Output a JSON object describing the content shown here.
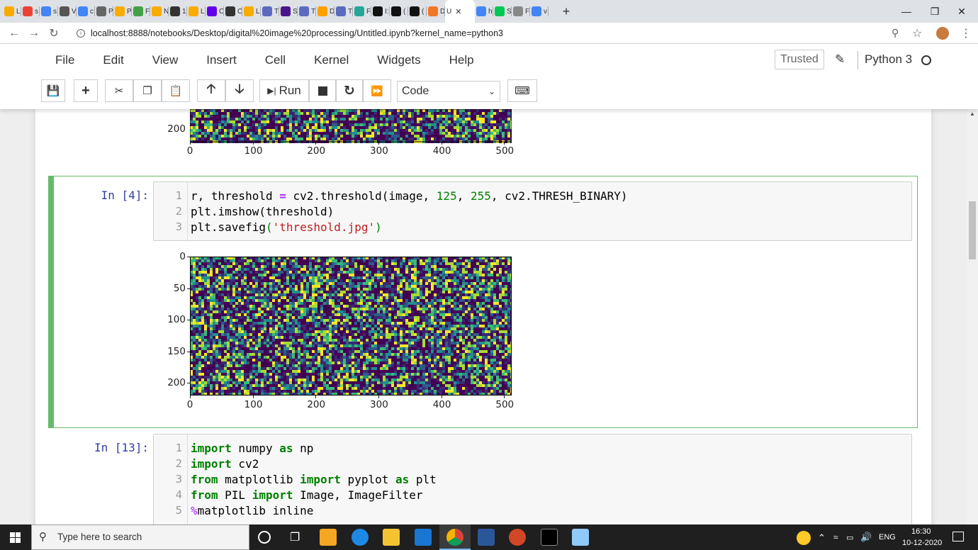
{
  "browser": {
    "tabs": [
      {
        "label": "L",
        "icon": "colab-icon",
        "color": "#f9ab00"
      },
      {
        "label": "s",
        "icon": "google-account-icon",
        "color": "#ea4335"
      },
      {
        "label": "s",
        "icon": "google-icon",
        "color": "#4285f4"
      },
      {
        "label": "V",
        "icon": "feather-icon",
        "color": "#555555"
      },
      {
        "label": "c",
        "icon": "google-icon",
        "color": "#4285f4"
      },
      {
        "label": "P",
        "icon": "diamond-icon",
        "color": "#666666"
      },
      {
        "label": "P",
        "icon": "colab-icon",
        "color": "#f9ab00"
      },
      {
        "label": "F",
        "icon": "b-icon",
        "color": "#43a047"
      },
      {
        "label": "N",
        "icon": "colab-icon",
        "color": "#f9ab00"
      },
      {
        "label": "1",
        "icon": "github-icon",
        "color": "#333333"
      },
      {
        "label": "L",
        "icon": "colab-icon",
        "color": "#f9ab00"
      },
      {
        "label": "C",
        "icon": "p-icon",
        "color": "#6200ea"
      },
      {
        "label": "C",
        "icon": "bolt-icon",
        "color": "#333333"
      },
      {
        "label": "L",
        "icon": "colab-icon",
        "color": "#f9ab00"
      },
      {
        "label": "T",
        "icon": "cloud-icon",
        "color": "#5c6bc0"
      },
      {
        "label": "S",
        "icon": "grid-icon",
        "color": "#4a148c"
      },
      {
        "label": "T",
        "icon": "cloud-icon",
        "color": "#5c6bc0"
      },
      {
        "label": "D",
        "icon": "wave-icon",
        "color": "#ffa000"
      },
      {
        "label": "T",
        "icon": "cloud-icon",
        "color": "#5c6bc0"
      },
      {
        "label": "F",
        "icon": "g-icon",
        "color": "#26a69a"
      },
      {
        "label": "I:",
        "icon": "github-icon",
        "color": "#111111"
      },
      {
        "label": "(",
        "icon": "github-icon",
        "color": "#111111"
      },
      {
        "label": "(",
        "icon": "github-icon",
        "color": "#111111"
      },
      {
        "label": "D",
        "icon": "jupyter-icon",
        "color": "#f37626"
      },
      {
        "label": "U",
        "icon": "none",
        "color": "#ffffff",
        "active": true
      },
      {
        "label": "h",
        "icon": "google-icon",
        "color": "#4285f4"
      },
      {
        "label": "S",
        "icon": "circle-icon",
        "color": "#00c853"
      },
      {
        "label": "F",
        "icon": "sst-icon",
        "color": "#888888"
      },
      {
        "label": "v",
        "icon": "google-icon",
        "color": "#4285f4"
      }
    ],
    "url": "localhost:8888/notebooks/Desktop/digital%20image%20processing/Untitled.ipynb?kernel_name=python3"
  },
  "menu": [
    "File",
    "Edit",
    "View",
    "Insert",
    "Cell",
    "Kernel",
    "Widgets",
    "Help"
  ],
  "header": {
    "trusted": "Trusted",
    "kernel": "Python 3"
  },
  "toolbar": {
    "run_label": "Run",
    "cell_type": "Code"
  },
  "cells": {
    "top_output": {
      "x_ticks": [
        "0",
        "100",
        "200",
        "300",
        "400",
        "500"
      ],
      "y_ticks_visible": [
        "200"
      ]
    },
    "cell4": {
      "prompt": "In [4]:",
      "line_numbers": [
        "1",
        "2",
        "3"
      ],
      "output": {
        "x_ticks": [
          "0",
          "100",
          "200",
          "300",
          "400",
          "500"
        ],
        "y_ticks": [
          "0",
          "50",
          "100",
          "150",
          "200"
        ]
      }
    },
    "cell13": {
      "prompt": "In [13]:",
      "line_numbers": [
        "1",
        "2",
        "3",
        "4",
        "5"
      ]
    }
  },
  "chart_data": [
    {
      "type": "heatmap",
      "x_ticks": [
        0,
        100,
        200,
        300,
        400,
        500
      ],
      "y_ticks": [
        200
      ],
      "colormap": "viridis"
    },
    {
      "type": "heatmap",
      "x_ticks": [
        0,
        100,
        200,
        300,
        400,
        500
      ],
      "y_ticks": [
        0,
        50,
        100,
        150,
        200
      ],
      "colormap": "viridis"
    }
  ],
  "taskbar": {
    "search_placeholder": "Type here to search",
    "lang": "ENG",
    "time": "16:30",
    "date": "10-12-2020"
  }
}
